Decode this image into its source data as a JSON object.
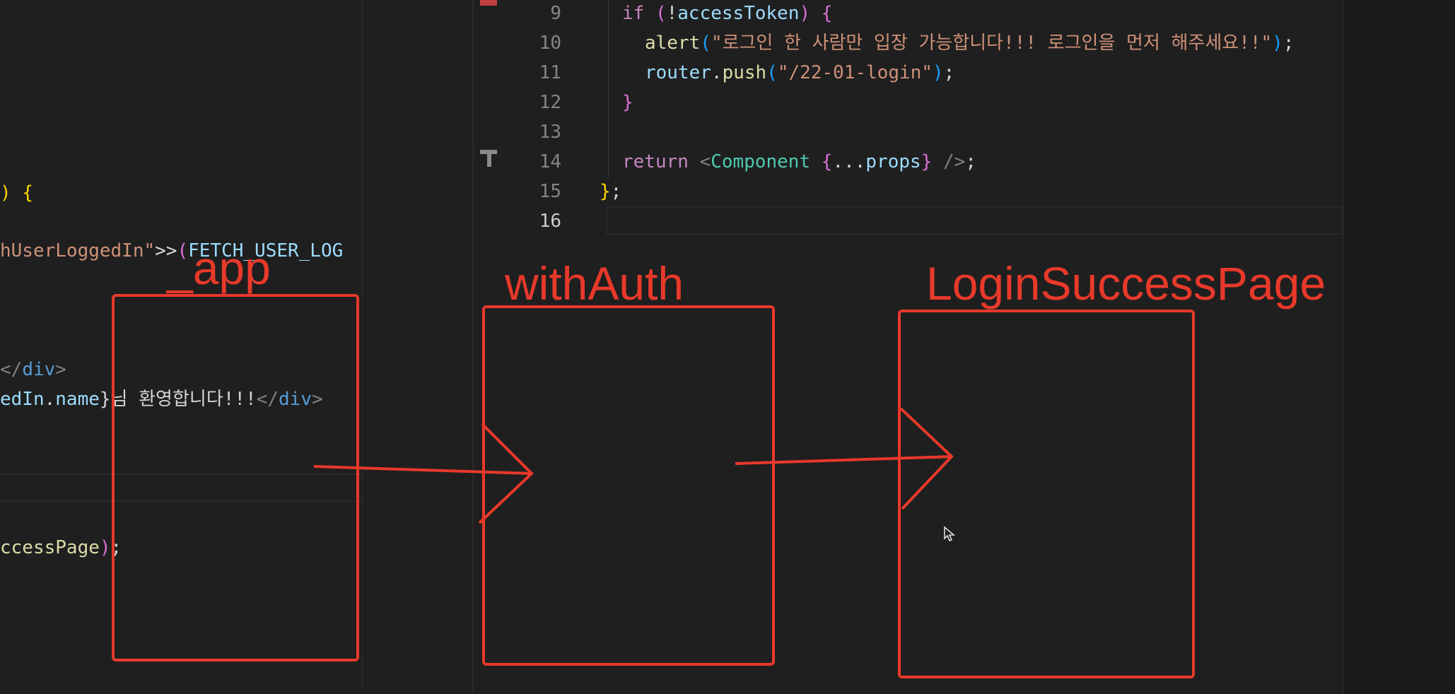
{
  "left_editor": {
    "lines": [
      {
        "seg": [
          [
            "brk1",
            ")"
          ],
          [
            "plain",
            " "
          ],
          [
            "brk1",
            "{"
          ]
        ]
      },
      {
        "seg": [
          [
            "str",
            "hUserLoggedIn\""
          ],
          [
            "plain",
            ">>"
          ],
          [
            "brk2",
            "("
          ],
          [
            "var",
            "FETCH_USER_LOG"
          ]
        ]
      },
      {
        "seg": [
          [
            "punc",
            "</"
          ],
          [
            "tag",
            "div"
          ],
          [
            "punc",
            ">"
          ]
        ]
      },
      {
        "seg": [
          [
            "var",
            "edIn"
          ],
          [
            "plain",
            "."
          ],
          [
            "var",
            "name"
          ],
          [
            "plain",
            "}님 환영합니다!!!"
          ],
          [
            "punc",
            "</"
          ],
          [
            "tag",
            "div"
          ],
          [
            "punc",
            ">"
          ]
        ]
      },
      {
        "seg": [
          [
            "fn",
            "ccessPage"
          ],
          [
            "brk2",
            ")"
          ],
          [
            "plain",
            ";"
          ]
        ]
      }
    ]
  },
  "right_editor": {
    "line_numbers": [
      "9",
      "10",
      "11",
      "12",
      "13",
      "14",
      "15",
      "16"
    ],
    "active_line": "16",
    "lines": [
      {
        "seg": [
          [
            "kw",
            "if"
          ],
          [
            "plain",
            " "
          ],
          [
            "brk2",
            "("
          ],
          [
            "plain",
            "!"
          ],
          [
            "var",
            "accessToken"
          ],
          [
            "brk2",
            ")"
          ],
          [
            "plain",
            " "
          ],
          [
            "brk2",
            "{"
          ]
        ]
      },
      {
        "seg": [
          [
            "fn",
            "alert"
          ],
          [
            "brk3",
            "("
          ],
          [
            "str",
            "\"로그인 한 사람만 입장 가능합니다!!! 로그인을 먼저 해주세요!!\""
          ],
          [
            "brk3",
            ")"
          ],
          [
            "plain",
            ";"
          ]
        ]
      },
      {
        "seg": [
          [
            "var",
            "router"
          ],
          [
            "plain",
            "."
          ],
          [
            "fn",
            "push"
          ],
          [
            "brk3",
            "("
          ],
          [
            "str",
            "\"/22-01-login\""
          ],
          [
            "brk3",
            ")"
          ],
          [
            "plain",
            ";"
          ]
        ]
      },
      {
        "seg": [
          [
            "brk2",
            "}"
          ]
        ]
      },
      {
        "seg": []
      },
      {
        "seg": [
          [
            "kw",
            "return"
          ],
          [
            "plain",
            " "
          ],
          [
            "punc",
            "<"
          ],
          [
            "cls",
            "Component"
          ],
          [
            "plain",
            " "
          ],
          [
            "brk2",
            "{"
          ],
          [
            "plain",
            "..."
          ],
          [
            "var",
            "props"
          ],
          [
            "brk2",
            "}"
          ],
          [
            "plain",
            " "
          ],
          [
            "punc",
            "/>"
          ],
          [
            "plain",
            ";"
          ]
        ]
      },
      {
        "seg": [
          [
            "brk1",
            "}"
          ],
          [
            "plain",
            ";"
          ]
        ]
      },
      {
        "seg": []
      }
    ]
  },
  "annotations": {
    "app_label": "_app",
    "with_auth_label": "withAuth",
    "login_success_label": "LoginSuccessPage"
  },
  "colors": {
    "annotation_red": "#e8392b",
    "editor_bg": "#1f1f1f"
  },
  "icons": {
    "mouse_cursor": "mouse-pointer-icon"
  }
}
